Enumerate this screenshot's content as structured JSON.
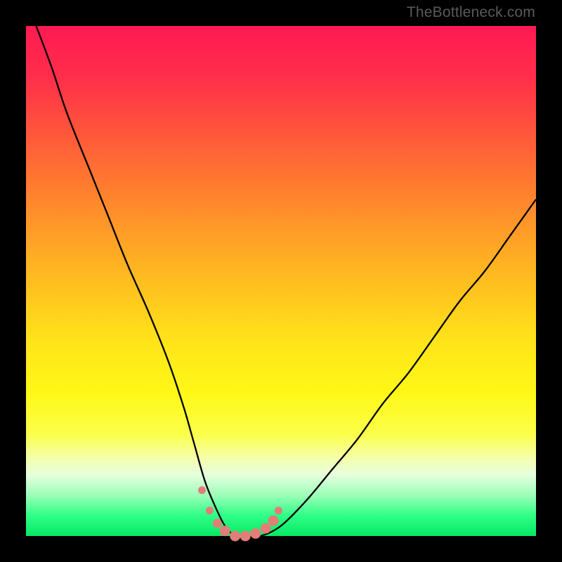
{
  "watermark": "TheBottleneck.com",
  "colors": {
    "background": "#000000",
    "curve_stroke": "#000000",
    "marker_fill": "#e37d78",
    "marker_stroke": "#e37d78"
  },
  "chart_data": {
    "type": "line",
    "title": "",
    "xlabel": "",
    "ylabel": "",
    "xlim": [
      0,
      100
    ],
    "ylim": [
      0,
      100
    ],
    "series": [
      {
        "name": "bottleneck-curve",
        "x": [
          2,
          5,
          8,
          12,
          16,
          20,
          24,
          28,
          31,
          33,
          35,
          37,
          39,
          41,
          43,
          46,
          50,
          55,
          60,
          65,
          70,
          75,
          80,
          85,
          90,
          95,
          100
        ],
        "values": [
          100,
          92,
          83,
          73,
          63,
          53,
          44,
          34,
          25,
          18,
          11,
          6,
          2,
          0,
          0,
          0,
          2,
          7,
          13,
          19,
          26,
          32,
          39,
          46,
          52,
          59,
          66
        ]
      }
    ],
    "markers": {
      "name": "trough-markers",
      "x": [
        34.5,
        36,
        37.5,
        39,
        41,
        43,
        45,
        47,
        48.5,
        49.5
      ],
      "values": [
        9,
        5,
        2.5,
        1,
        0,
        0,
        0.5,
        1.5,
        3,
        5
      ],
      "radius": [
        5,
        5,
        6,
        7,
        7,
        7,
        7,
        7,
        7,
        5
      ]
    }
  }
}
